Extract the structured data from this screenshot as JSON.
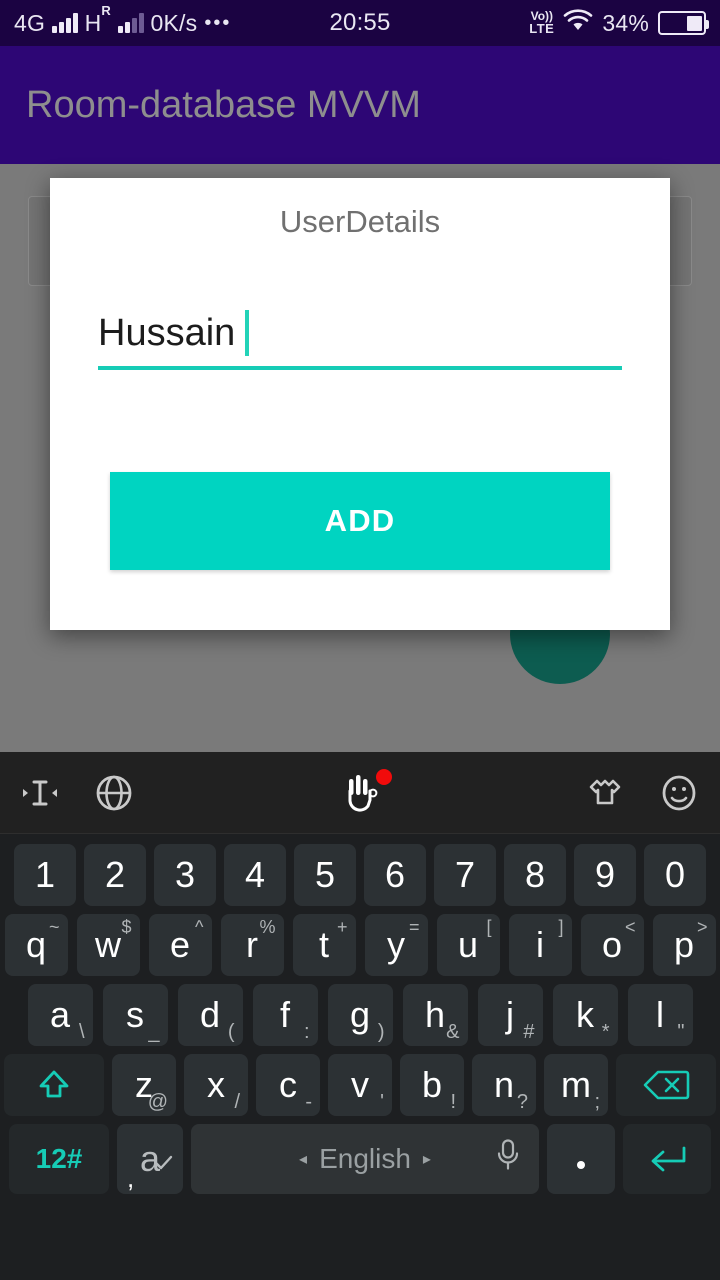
{
  "statusbar": {
    "network_4g": "4G",
    "network_h": "H",
    "network_h_sup": "R",
    "data_speed": "0K/s",
    "more_dots": "•••",
    "time": "20:55",
    "volte_top": "Vo))",
    "volte_bottom": "LTE",
    "battery_percent": "34%"
  },
  "appbar": {
    "title": "Room-database MVVM"
  },
  "dialog": {
    "title": "UserDetails",
    "input_value": "Hussain",
    "input_placeholder": "",
    "add_label": "ADD"
  },
  "keyboard": {
    "toolbar": [
      {
        "name": "cursor-move-icon",
        "label": "cursor-move"
      },
      {
        "name": "globe-icon",
        "label": "language"
      },
      {
        "name": "hand-gesture-icon",
        "label": "gesture",
        "badge": true
      },
      {
        "name": "tshirt-icon",
        "label": "theme"
      },
      {
        "name": "emoji-icon",
        "label": "emoji"
      }
    ],
    "row_numbers": [
      {
        "main": "1"
      },
      {
        "main": "2"
      },
      {
        "main": "3"
      },
      {
        "main": "4"
      },
      {
        "main": "5"
      },
      {
        "main": "6"
      },
      {
        "main": "7"
      },
      {
        "main": "8"
      },
      {
        "main": "9"
      },
      {
        "main": "0"
      }
    ],
    "row_q": [
      {
        "main": "q",
        "sup": "~"
      },
      {
        "main": "w",
        "sup": "$"
      },
      {
        "main": "e",
        "sup": "^"
      },
      {
        "main": "r",
        "sup": "%"
      },
      {
        "main": "t",
        "sup": "+"
      },
      {
        "main": "y",
        "sup": "="
      },
      {
        "main": "u",
        "sup": "["
      },
      {
        "main": "i",
        "sup": "]"
      },
      {
        "main": "o",
        "sup": "<"
      },
      {
        "main": "p",
        "sup": ">"
      }
    ],
    "row_a": [
      {
        "main": "a",
        "sub": "\\"
      },
      {
        "main": "s",
        "sub": "_"
      },
      {
        "main": "d",
        "sub": "("
      },
      {
        "main": "f",
        "sub": ":"
      },
      {
        "main": "g",
        "sub": ")"
      },
      {
        "main": "h",
        "sub": "&"
      },
      {
        "main": "j",
        "sub": "#"
      },
      {
        "main": "k",
        "sub": "*"
      },
      {
        "main": "l",
        "sub": "\""
      }
    ],
    "row_z": [
      {
        "main": "z",
        "sub": "@"
      },
      {
        "main": "x",
        "sub": "/"
      },
      {
        "main": "c",
        "sub": "-"
      },
      {
        "main": "v",
        "sub": "'"
      },
      {
        "main": "b",
        "sub": "!"
      },
      {
        "main": "n",
        "sub": "?"
      },
      {
        "main": "m",
        "sub": ";"
      }
    ],
    "shift_label": "shift-icon",
    "backspace_label": "backspace-icon",
    "symbols_label": "12#",
    "spellcheck_main": "a",
    "spellcheck_sub": ",",
    "space_label": "English",
    "space_arrow_left": "◂",
    "space_arrow_right": "▸",
    "period_label": ".",
    "enter_label": "enter-icon"
  },
  "colors": {
    "statusbar_bg": "#1b0342",
    "appbar_bg": "#2d0675",
    "appbar_title": "#8e8e8e",
    "accent_teal": "#00d4c1",
    "underline_teal": "#16ccb6",
    "handle_blue": "#2f8fe8",
    "scrim_gray": "#7a7a7a",
    "fab_teal": "#0d5c50",
    "keyboard_bg": "#1d1f21",
    "key_bg": "#2c3134",
    "badge_red": "#f10b0b"
  }
}
